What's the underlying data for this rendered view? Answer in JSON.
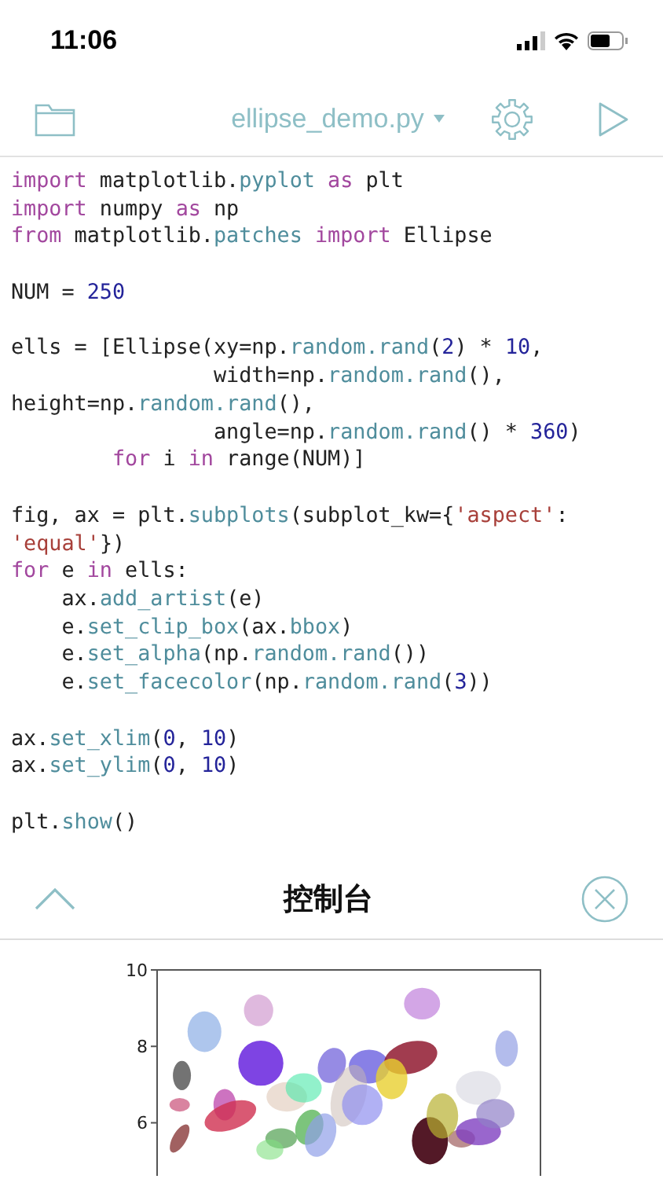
{
  "status_bar": {
    "time": "11:06"
  },
  "toolbar": {
    "file_name": "ellipse_demo.py"
  },
  "code_lines": [
    {
      "space_before": false,
      "tokens": [
        {
          "t": "import",
          "kind": "keyword"
        },
        {
          "t": " matplotlib.",
          "kind": "plain"
        },
        {
          "t": "pyplot",
          "kind": "attr"
        },
        {
          "t": " as",
          "kind": "keyword"
        },
        {
          "t": " plt",
          "kind": "plain"
        }
      ]
    },
    {
      "space_before": false,
      "tokens": [
        {
          "t": "import",
          "kind": "keyword"
        },
        {
          "t": " numpy ",
          "kind": "plain"
        },
        {
          "t": "as",
          "kind": "keyword"
        },
        {
          "t": " np",
          "kind": "plain"
        }
      ]
    },
    {
      "space_before": false,
      "tokens": [
        {
          "t": "from",
          "kind": "keyword"
        },
        {
          "t": " matplotlib.",
          "kind": "plain"
        },
        {
          "t": "patches",
          "kind": "attr"
        },
        {
          "t": " import",
          "kind": "keyword"
        },
        {
          "t": " Ellipse",
          "kind": "plain"
        }
      ]
    },
    {
      "space_before": true,
      "tokens": [
        {
          "t": "NUM = ",
          "kind": "plain"
        },
        {
          "t": "250",
          "kind": "number"
        }
      ]
    },
    {
      "space_before": true,
      "tokens": [
        {
          "t": "ells = [Ellipse(xy=np.",
          "kind": "plain"
        },
        {
          "t": "random.rand",
          "kind": "attr"
        },
        {
          "t": "(",
          "kind": "plain"
        },
        {
          "t": "2",
          "kind": "number"
        },
        {
          "t": ") * ",
          "kind": "plain"
        },
        {
          "t": "10",
          "kind": "number"
        },
        {
          "t": ",",
          "kind": "plain"
        }
      ]
    },
    {
      "space_before": false,
      "tokens": [
        {
          "t": "                width=np.",
          "kind": "plain"
        },
        {
          "t": "random.rand",
          "kind": "attr"
        },
        {
          "t": "(),",
          "kind": "plain"
        }
      ]
    },
    {
      "space_before": false,
      "tokens": [
        {
          "t": "height=np.",
          "kind": "plain"
        },
        {
          "t": "random.rand",
          "kind": "attr"
        },
        {
          "t": "(),",
          "kind": "plain"
        }
      ]
    },
    {
      "space_before": false,
      "tokens": [
        {
          "t": "                angle=np.",
          "kind": "plain"
        },
        {
          "t": "random.rand",
          "kind": "attr"
        },
        {
          "t": "() * ",
          "kind": "plain"
        },
        {
          "t": "360",
          "kind": "number"
        },
        {
          "t": ")",
          "kind": "plain"
        }
      ]
    },
    {
      "space_before": false,
      "tokens": [
        {
          "t": "        for",
          "kind": "keyword"
        },
        {
          "t": " i ",
          "kind": "plain"
        },
        {
          "t": "in",
          "kind": "keyword"
        },
        {
          "t": " range(NUM)]",
          "kind": "plain"
        }
      ]
    },
    {
      "space_before": true,
      "tokens": [
        {
          "t": "fig, ax = plt.",
          "kind": "plain"
        },
        {
          "t": "subplots",
          "kind": "attr"
        },
        {
          "t": "(subplot_kw={",
          "kind": "plain"
        },
        {
          "t": "'aspect'",
          "kind": "string"
        },
        {
          "t": ":",
          "kind": "plain"
        }
      ]
    },
    {
      "space_before": false,
      "tokens": [
        {
          "t": "'equal'",
          "kind": "string"
        },
        {
          "t": "})",
          "kind": "plain"
        }
      ]
    },
    {
      "space_before": false,
      "tokens": [
        {
          "t": "for",
          "kind": "keyword"
        },
        {
          "t": " e ",
          "kind": "plain"
        },
        {
          "t": "in",
          "kind": "keyword"
        },
        {
          "t": " ells:",
          "kind": "plain"
        }
      ]
    },
    {
      "space_before": false,
      "tokens": [
        {
          "t": "    ax.",
          "kind": "plain"
        },
        {
          "t": "add_artist",
          "kind": "attr"
        },
        {
          "t": "(e)",
          "kind": "plain"
        }
      ]
    },
    {
      "space_before": false,
      "tokens": [
        {
          "t": "    e.",
          "kind": "plain"
        },
        {
          "t": "set_clip_box",
          "kind": "attr"
        },
        {
          "t": "(ax.",
          "kind": "plain"
        },
        {
          "t": "bbox",
          "kind": "attr"
        },
        {
          "t": ")",
          "kind": "plain"
        }
      ]
    },
    {
      "space_before": false,
      "tokens": [
        {
          "t": "    e.",
          "kind": "plain"
        },
        {
          "t": "set_alpha",
          "kind": "attr"
        },
        {
          "t": "(np.",
          "kind": "plain"
        },
        {
          "t": "random.rand",
          "kind": "attr"
        },
        {
          "t": "())",
          "kind": "plain"
        }
      ]
    },
    {
      "space_before": false,
      "tokens": [
        {
          "t": "    e.",
          "kind": "plain"
        },
        {
          "t": "set_facecolor",
          "kind": "attr"
        },
        {
          "t": "(np.",
          "kind": "plain"
        },
        {
          "t": "random.rand",
          "kind": "attr"
        },
        {
          "t": "(",
          "kind": "plain"
        },
        {
          "t": "3",
          "kind": "number"
        },
        {
          "t": "))",
          "kind": "plain"
        }
      ]
    },
    {
      "space_before": true,
      "tokens": [
        {
          "t": "ax.",
          "kind": "plain"
        },
        {
          "t": "set_xlim",
          "kind": "attr"
        },
        {
          "t": "(",
          "kind": "plain"
        },
        {
          "t": "0",
          "kind": "number"
        },
        {
          "t": ", ",
          "kind": "plain"
        },
        {
          "t": "10",
          "kind": "number"
        },
        {
          "t": ")",
          "kind": "plain"
        }
      ]
    },
    {
      "space_before": false,
      "tokens": [
        {
          "t": "ax.",
          "kind": "plain"
        },
        {
          "t": "set_ylim",
          "kind": "attr"
        },
        {
          "t": "(",
          "kind": "plain"
        },
        {
          "t": "0",
          "kind": "number"
        },
        {
          "t": ", ",
          "kind": "plain"
        },
        {
          "t": "10",
          "kind": "number"
        },
        {
          "t": ")",
          "kind": "plain"
        }
      ]
    },
    {
      "space_before": true,
      "tokens": [
        {
          "t": "plt.",
          "kind": "plain"
        },
        {
          "t": "show",
          "kind": "attr"
        },
        {
          "t": "()",
          "kind": "plain"
        }
      ]
    }
  ],
  "console": {
    "title": "控制台",
    "plot": {
      "y_tick_labels": [
        "10",
        "8",
        "6"
      ]
    }
  }
}
